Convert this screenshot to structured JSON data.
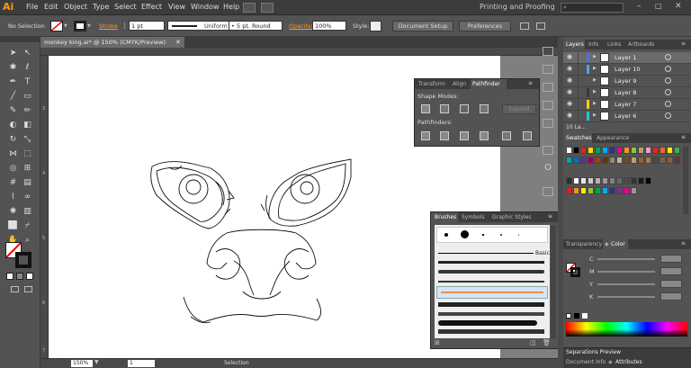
{
  "app": {
    "logo": "Ai"
  },
  "menu": [
    "File",
    "Edit",
    "Object",
    "Type",
    "Select",
    "Effect",
    "View",
    "Window",
    "Help"
  ],
  "workspace": {
    "label": "Printing and Proofing"
  },
  "search": {
    "placeholder": ""
  },
  "control": {
    "selection_label": "No Selection",
    "stroke_label": "Stroke",
    "stroke_weight": "1 pt",
    "profile": "Uniform",
    "brush": "5 pt. Round",
    "opacity_label": "Opacity:",
    "opacity_value": "100%",
    "style_label": "Style:",
    "doc_setup": "Document Setup",
    "preferences": "Preferences"
  },
  "document": {
    "tab_title": "monkey king.ai* @ 150% (CMYK/Preview)"
  },
  "rulers": {
    "left_marks": [
      "3",
      "4",
      "5",
      "6",
      "7"
    ]
  },
  "pathfinder_panel": {
    "tabs": [
      "Transform",
      "Align",
      "Pathfinder"
    ],
    "shape_modes": "Shape Modes:",
    "pathfinders": "Pathfinders:",
    "expand": "Expand"
  },
  "brushes_panel": {
    "tabs": [
      "Brushes",
      "Symbols",
      "Graphic Styles"
    ],
    "basic": "Basic"
  },
  "layers_panel": {
    "tabs": [
      "Layers",
      "Info",
      "Links",
      "Artboards"
    ],
    "layers": [
      {
        "name": "Layer 1",
        "color": "#4f6fff"
      },
      {
        "name": "Layer 10",
        "color": "#4fa0ff"
      },
      {
        "name": "Layer 9",
        "color": "#555555"
      },
      {
        "name": "Layer 8",
        "color": "#3a3a3a"
      },
      {
        "name": "Layer 7",
        "color": "#f0d000"
      },
      {
        "name": "Layer 6",
        "color": "#29c0e0"
      }
    ],
    "footer": "10 La..."
  },
  "swatches_panel": {
    "tabs": [
      "Swatches",
      "Appearance"
    ]
  },
  "color_panel": {
    "tabs": [
      "Transparency",
      "Color"
    ],
    "channels": [
      "C",
      "M",
      "Y",
      "K"
    ]
  },
  "separations": {
    "label": "Separations Preview"
  },
  "docinfo": {
    "tabs": [
      "Document Info",
      "Attributes"
    ]
  },
  "status": {
    "zoom": "150%",
    "page": "1",
    "mode": "Selection"
  }
}
